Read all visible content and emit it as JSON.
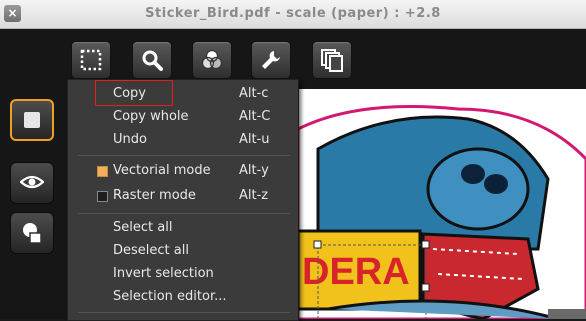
{
  "window": {
    "title": "Sticker_Bird.pdf - scale (paper) : +2.8",
    "close_glyph": "×"
  },
  "toolbar": {
    "icons": [
      "selection-icon",
      "magnifier-icon",
      "color-channels-icon",
      "wrench-icon",
      "pages-icon"
    ]
  },
  "sidebar": {
    "icons": [
      "square-mode-icon",
      "eye-icon",
      "shapes-icon"
    ],
    "active_color": "#f0a020"
  },
  "document": {
    "label_text": "DERA"
  },
  "context_menu": {
    "groups": [
      [
        {
          "label": "Copy",
          "shortcut": "Alt-c"
        },
        {
          "label": "Copy whole",
          "shortcut": "Alt-C"
        },
        {
          "label": "Undo",
          "shortcut": "Alt-u"
        }
      ],
      [
        {
          "label": "Vectorial mode",
          "shortcut": "Alt-y",
          "checked": true
        },
        {
          "label": "Raster mode",
          "shortcut": "Alt-z",
          "checked": false
        }
      ],
      [
        {
          "label": "Select all"
        },
        {
          "label": "Deselect all"
        },
        {
          "label": "Invert selection"
        },
        {
          "label": "Selection editor..."
        }
      ]
    ]
  },
  "colors": {
    "highlight_box": "#e0201c",
    "menu_bg": "#3b3b3b"
  }
}
